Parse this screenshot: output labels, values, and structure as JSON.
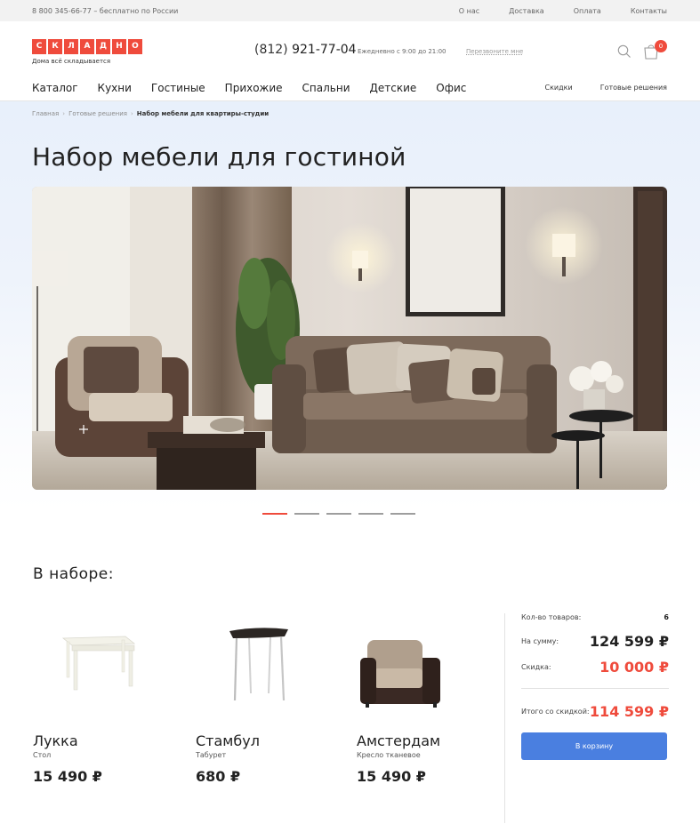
{
  "topbar": {
    "phone_free": "8 800 345-66-77 – бесплатно по России",
    "links": [
      "О нас",
      "Доставка",
      "Оплата",
      "Контакты"
    ]
  },
  "header": {
    "logo_letters": [
      "С",
      "К",
      "Л",
      "А",
      "Д",
      "Н",
      "О"
    ],
    "tagline": "Дома всё складывается",
    "phone_code": "(812)",
    "phone_number": "921-77-04",
    "hours": "Ежедневно с 9:00 до 21:00",
    "callback": "Перезвоните мне",
    "cart_count": "0"
  },
  "nav": {
    "main": [
      "Каталог",
      "Кухни",
      "Гостиные",
      "Прихожие",
      "Спальни",
      "Детские",
      "Офис"
    ],
    "extra": [
      "Скидки",
      "Готовые решения"
    ]
  },
  "breadcrumb": {
    "home": "Главная",
    "section": "Готовые решения",
    "current": "Набор мебели для квартиры-студии"
  },
  "page_title": "Набор мебели для гостиной",
  "slider": {
    "slides": 5,
    "active": 1
  },
  "set": {
    "title": "В наборе:",
    "products": [
      {
        "name": "Лукка",
        "type": "Стол",
        "price": "15 490 ₽",
        "icon": "table-image"
      },
      {
        "name": "Стамбул",
        "type": "Табурет",
        "price": "680 ₽",
        "icon": "stool-image"
      },
      {
        "name": "Амстердам",
        "type": "Кресло тканевое",
        "price": "15 490 ₽",
        "icon": "armchair-image"
      }
    ]
  },
  "summary": {
    "count_label": "Кол-во товаров:",
    "count_value": "6",
    "sum_label": "На сумму:",
    "sum_value": "124 599 ₽",
    "discount_label": "Скидка:",
    "discount_value": "10 000 ₽",
    "total_label": "Итого со скидкой:",
    "total_value": "114 599 ₽",
    "cart_button": "В корзину"
  },
  "colors": {
    "accent": "#ef4b3c",
    "button": "#4a7fe0"
  }
}
